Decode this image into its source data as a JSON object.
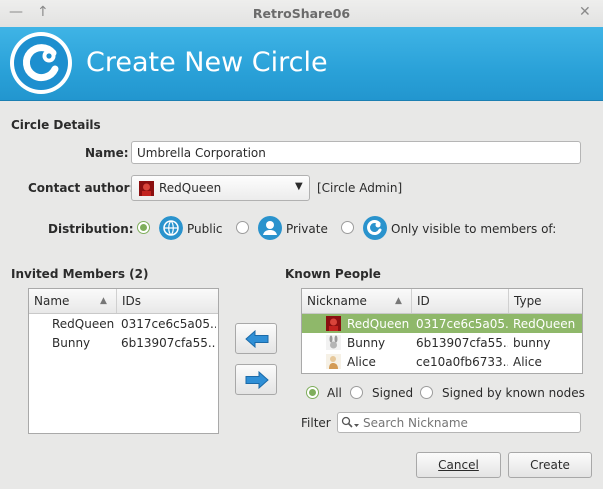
{
  "window": {
    "title": "RetroShare06"
  },
  "banner": {
    "title": "Create New Circle"
  },
  "circle_details": {
    "heading": "Circle Details",
    "name_label": "Name:",
    "name_value": "Umbrella Corporation",
    "author_label": "Contact author:",
    "author_value": "RedQueen",
    "author_role": "[Circle Admin]",
    "distribution_label": "Distribution:",
    "distribution_options": [
      {
        "label": "Public",
        "selected": true,
        "icon": "globe-icon"
      },
      {
        "label": "Private",
        "selected": false,
        "icon": "person-icon"
      },
      {
        "label": "Only visible to members of:",
        "selected": false,
        "icon": "circle-icon"
      }
    ]
  },
  "invited": {
    "heading": "Invited Members (2)",
    "columns": [
      "Name",
      "IDs"
    ],
    "rows": [
      {
        "name": "RedQueen",
        "id": "0317ce6c5a05..."
      },
      {
        "name": "Bunny",
        "id": "6b13907cfa55..."
      }
    ]
  },
  "known": {
    "heading": "Known People",
    "columns": [
      "Nickname",
      "ID",
      "Type"
    ],
    "rows": [
      {
        "nickname": "RedQueen",
        "id": "0317ce6c5a05...",
        "type": "RedQueen",
        "selected": true
      },
      {
        "nickname": "Bunny",
        "id": "6b13907cfa55...",
        "type": "bunny",
        "selected": false
      },
      {
        "nickname": "Alice",
        "id": "ce10a0fb6733...",
        "type": "Alice",
        "selected": false
      }
    ],
    "filters": [
      {
        "label": "All",
        "selected": true
      },
      {
        "label": "Signed",
        "selected": false
      },
      {
        "label": "Signed by known nodes",
        "selected": false
      }
    ],
    "filter_label": "Filter",
    "search_placeholder": "Search Nickname"
  },
  "buttons": {
    "cancel": "Cancel",
    "create": "Create"
  },
  "colors": {
    "accent": "#2aa1d8",
    "selection": "#8fb86a",
    "radio_on": "#7fae5c"
  }
}
